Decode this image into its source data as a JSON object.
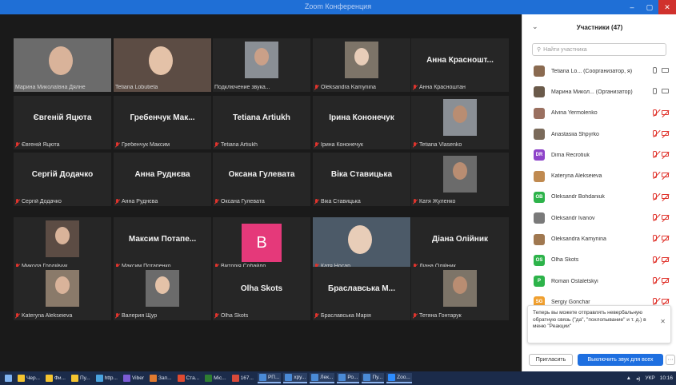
{
  "window": {
    "title": "Zoom Конференция"
  },
  "window_controls": {
    "minimize": "–",
    "maximize": "▢",
    "close": "✕"
  },
  "gallery": {
    "tiles": [
      {
        "name": "Марина Миколаївна Дялне",
        "video": true,
        "muted": false,
        "active": true
      },
      {
        "name": "Tetiana Lobutieta",
        "video": true,
        "muted": false
      },
      {
        "name": "Подключение звука...",
        "video": true,
        "muted": false
      },
      {
        "name": "Oleksandra Kamynina",
        "video": true,
        "muted": true
      },
      {
        "name": "Анна Красношт...",
        "caption": "Анна Красноштан",
        "video": false,
        "muted": true
      },
      {
        "name": "Євгеній Яцюта",
        "caption": "Євгеній Яцюта",
        "video": false,
        "muted": true
      },
      {
        "name": "Гребенчук Мак...",
        "caption": "Гребенчук Максим",
        "video": false,
        "muted": true
      },
      {
        "name": "Tetiana Artiukh",
        "caption": "Tetiana Artiukh",
        "video": false,
        "muted": true
      },
      {
        "name": "Ірина Кононечук",
        "caption": "Ірина Кононечук",
        "video": false,
        "muted": true
      },
      {
        "name": "Tetiana Vlasenko",
        "video": true,
        "muted": true
      },
      {
        "name": "Сергій Додачко",
        "caption": "Сергій Додачко",
        "video": false,
        "muted": true
      },
      {
        "name": "Анна Руднєва",
        "caption": "Анна Руднєва",
        "video": false,
        "muted": true
      },
      {
        "name": "Оксана Гулевата",
        "caption": "Оксана Гулевата",
        "video": false,
        "muted": true
      },
      {
        "name": "Віка Ставицька",
        "caption": "Віка Ставицька",
        "video": false,
        "muted": true
      },
      {
        "name": "Катя Жуленко",
        "video": true,
        "muted": true
      },
      {
        "name": "Микола Гордійчук",
        "video": true,
        "muted": true
      },
      {
        "name": "Максим Потапе...",
        "caption": "Максим Потапенко",
        "video": false,
        "muted": true
      },
      {
        "name": "Вікторія Собайло",
        "avatar": "B",
        "video": false,
        "muted": true
      },
      {
        "name": "Катя Носар",
        "video": true,
        "muted": true
      },
      {
        "name": "Діана Олійник",
        "caption": "Діана Олійник",
        "video": false,
        "muted": true
      },
      {
        "name": "Kateryna Alekseieva",
        "video": true,
        "muted": true
      },
      {
        "name": "Валерия Щур",
        "video": true,
        "muted": true
      },
      {
        "name": "Olha Skots",
        "caption": "Olha Skots",
        "video": false,
        "muted": true
      },
      {
        "name": "Браславська М...",
        "caption": "Браславська Марія",
        "video": false,
        "muted": true
      },
      {
        "name": "Тетяна Гонтарук",
        "video": true,
        "muted": true
      }
    ]
  },
  "participants": {
    "title": "Участники (47)",
    "collapse_icon": "chevron-down-icon",
    "search_placeholder": "Найти участника",
    "items": [
      {
        "name": "Tetiana Lo... (Соорганизатор, я)",
        "initials": "",
        "color": "#8a6a50",
        "mic_muted": false,
        "cam_muted": false
      },
      {
        "name": "Марина Микол... (Организатор)",
        "initials": "",
        "color": "#6a5a4a",
        "mic_muted": false,
        "cam_muted": false
      },
      {
        "name": "Alvina Yermolenko",
        "initials": "",
        "color": "#9a7060",
        "mic_muted": true,
        "cam_muted": true
      },
      {
        "name": "Anastasiia Shpyrko",
        "initials": "",
        "color": "#7a6a5a",
        "mic_muted": true,
        "cam_muted": true
      },
      {
        "name": "Dima Recrotiuk",
        "initials": "DR",
        "color": "#8e44c9",
        "mic_muted": true,
        "cam_muted": true
      },
      {
        "name": "Kateryna Alekseieva",
        "initials": "",
        "color": "#c08a50",
        "mic_muted": true,
        "cam_muted": true
      },
      {
        "name": "Oleksandr Bohdaniuk",
        "initials": "OB",
        "color": "#2db34a",
        "mic_muted": true,
        "cam_muted": true
      },
      {
        "name": "Oleksandr Ivanov",
        "initials": "",
        "color": "#7a7a7a",
        "mic_muted": true,
        "cam_muted": true
      },
      {
        "name": "Oleksandra Kamynina",
        "initials": "",
        "color": "#a07850",
        "mic_muted": true,
        "cam_muted": true
      },
      {
        "name": "Olha Skots",
        "initials": "OS",
        "color": "#2db34a",
        "mic_muted": true,
        "cam_muted": true
      },
      {
        "name": "Roman Ostaletskyi",
        "initials": "P",
        "color": "#2db34a",
        "mic_muted": true,
        "cam_muted": true
      },
      {
        "name": "Sergiy Gonchar",
        "initials": "SG",
        "color": "#f0a030",
        "mic_muted": true,
        "cam_muted": true
      }
    ],
    "notice": "Теперь вы можете отправлять невербальную обратную связь (\"да\", \"похлопывание\" и т. д.) в меню \"Реакции\"",
    "invite_label": "Пригласить",
    "unmute_all_label": "Выключить звук для всех",
    "more_label": "···"
  },
  "taskbar": {
    "items": [
      "Чер...",
      "Фи...",
      "Пу...",
      "http...",
      "Viber",
      "Зап...",
      "Ста...",
      "Mic...",
      "167...",
      "РП...",
      "хру...",
      "Лек...",
      "Ро...",
      "Пу...",
      "Zoo..."
    ],
    "language": "УКР",
    "time": "10:16"
  }
}
